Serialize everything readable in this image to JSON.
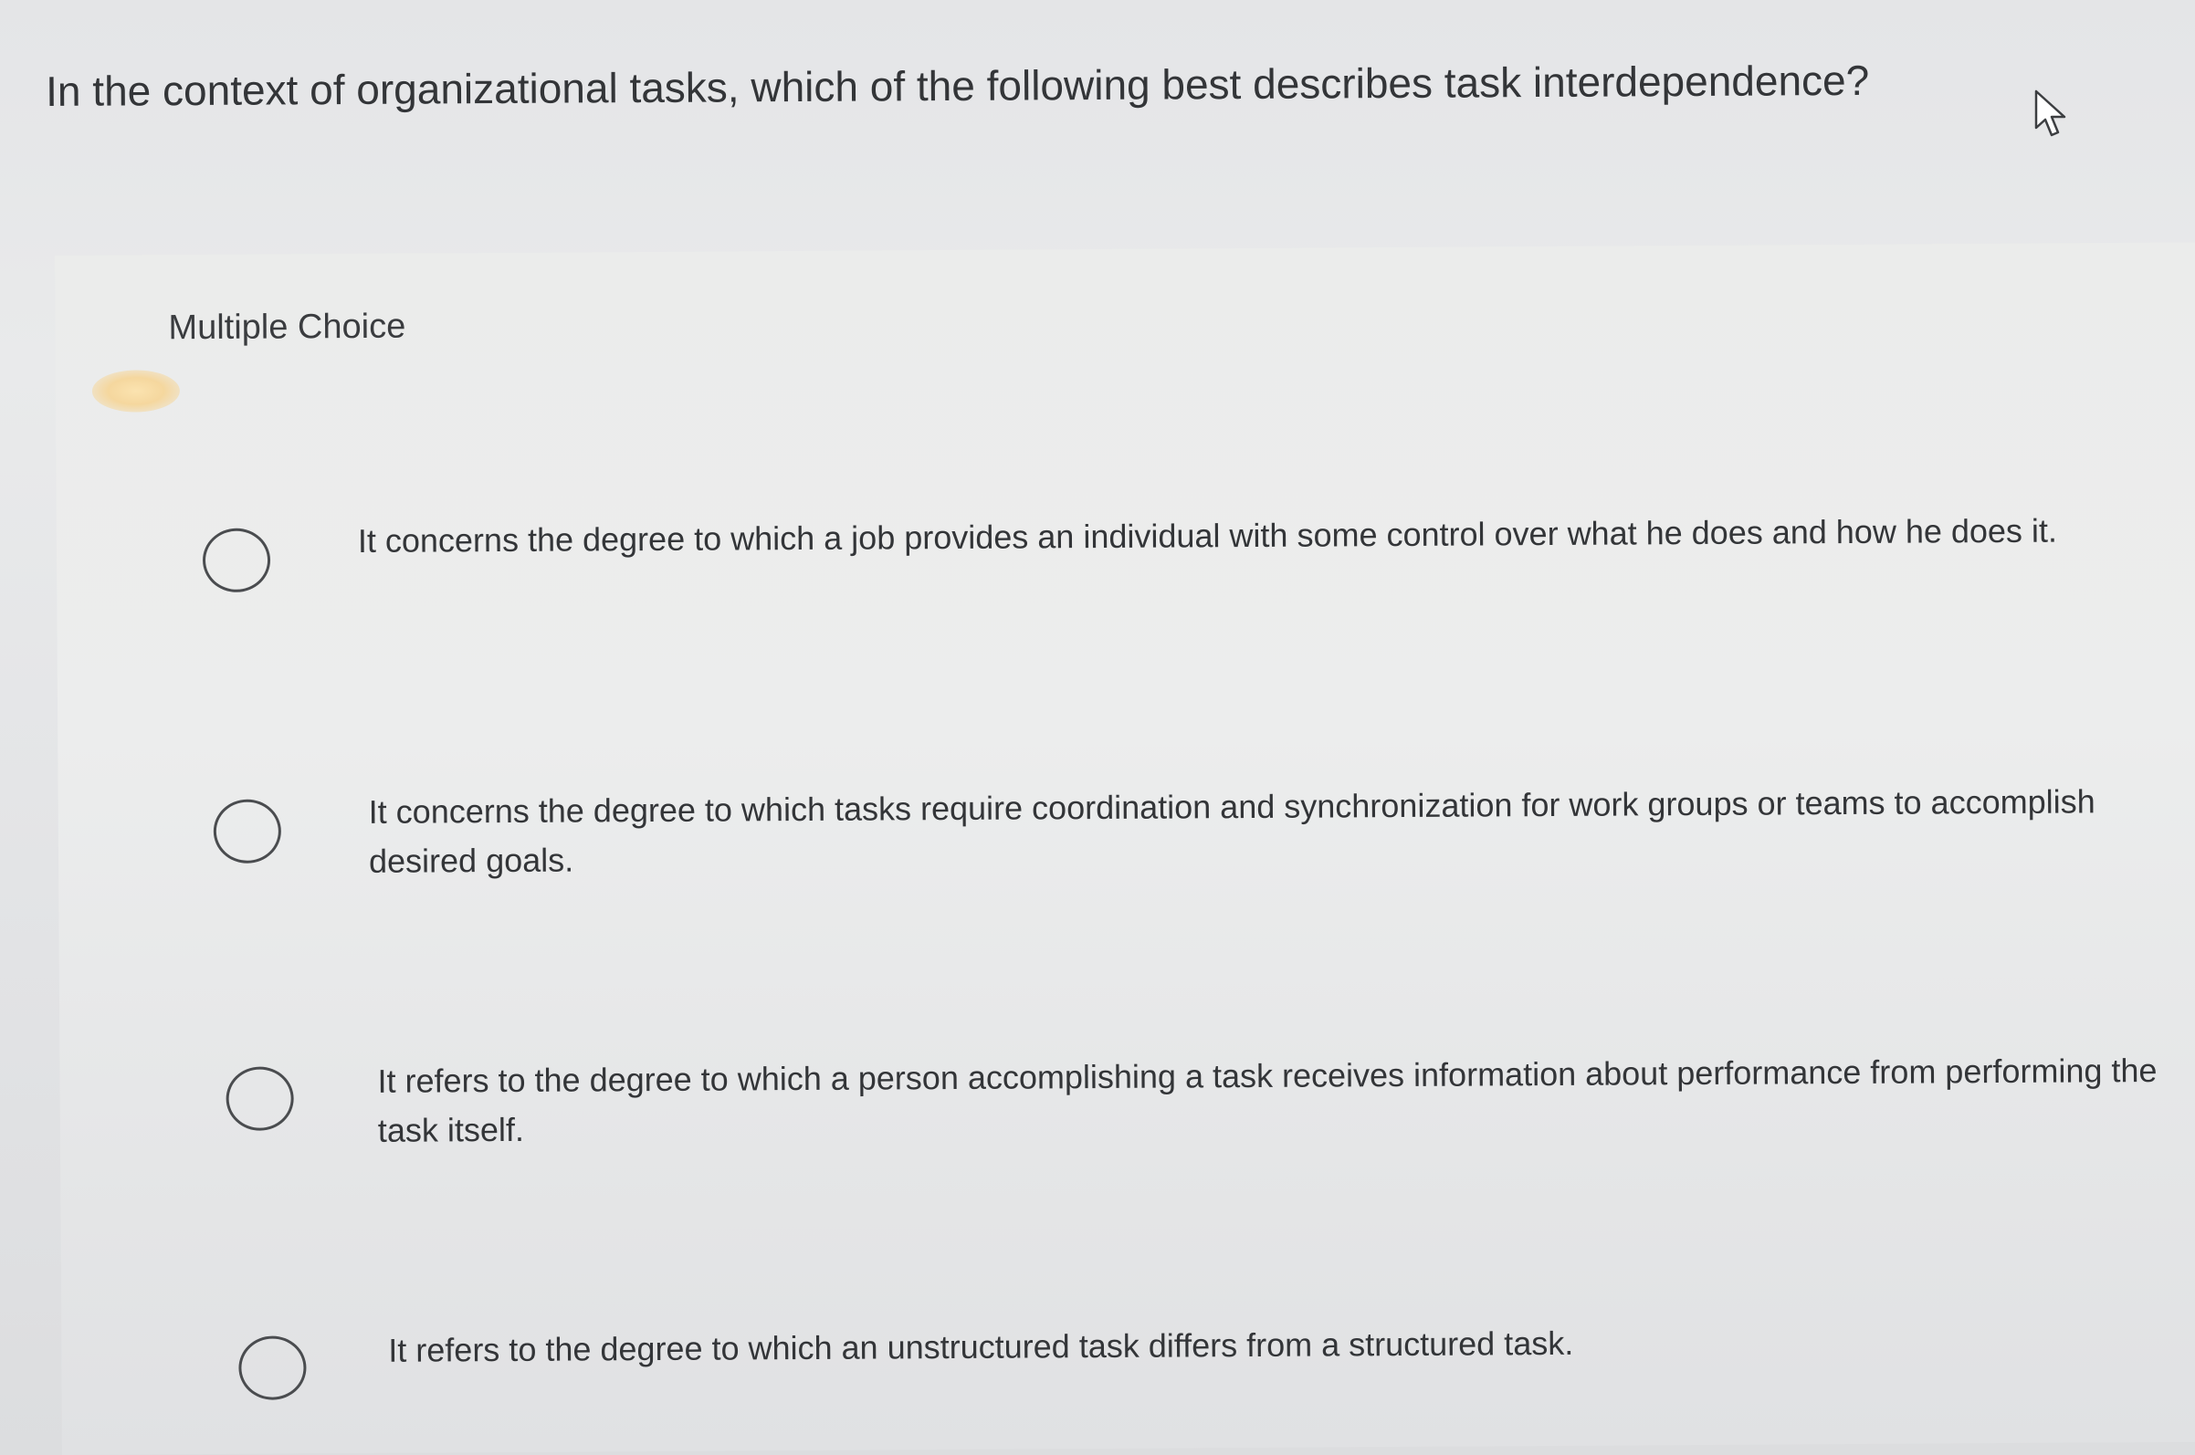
{
  "question": {
    "text": "In the context of organizational tasks, which of the following best describes task interdependence?"
  },
  "panel": {
    "label": "Multiple Choice"
  },
  "choices": [
    {
      "text": "It concerns the degree to which a job provides an individual with some control over what he does and how he does it."
    },
    {
      "text": "It concerns the degree to which tasks require coordination and synchronization for work groups or teams to accomplish desired goals."
    },
    {
      "text": "It refers to the degree to which a person accomplishing a task receives information about performance from performing the task itself."
    },
    {
      "text": "It refers to the degree to which an unstructured task differs from a structured task."
    }
  ],
  "icons": {
    "cursor": "mouse-pointer-icon",
    "radio": "radio-unselected-icon"
  },
  "colors": {
    "background": "#e6e7e8",
    "text": "#333538",
    "radio_border": "#4a4c4f"
  }
}
